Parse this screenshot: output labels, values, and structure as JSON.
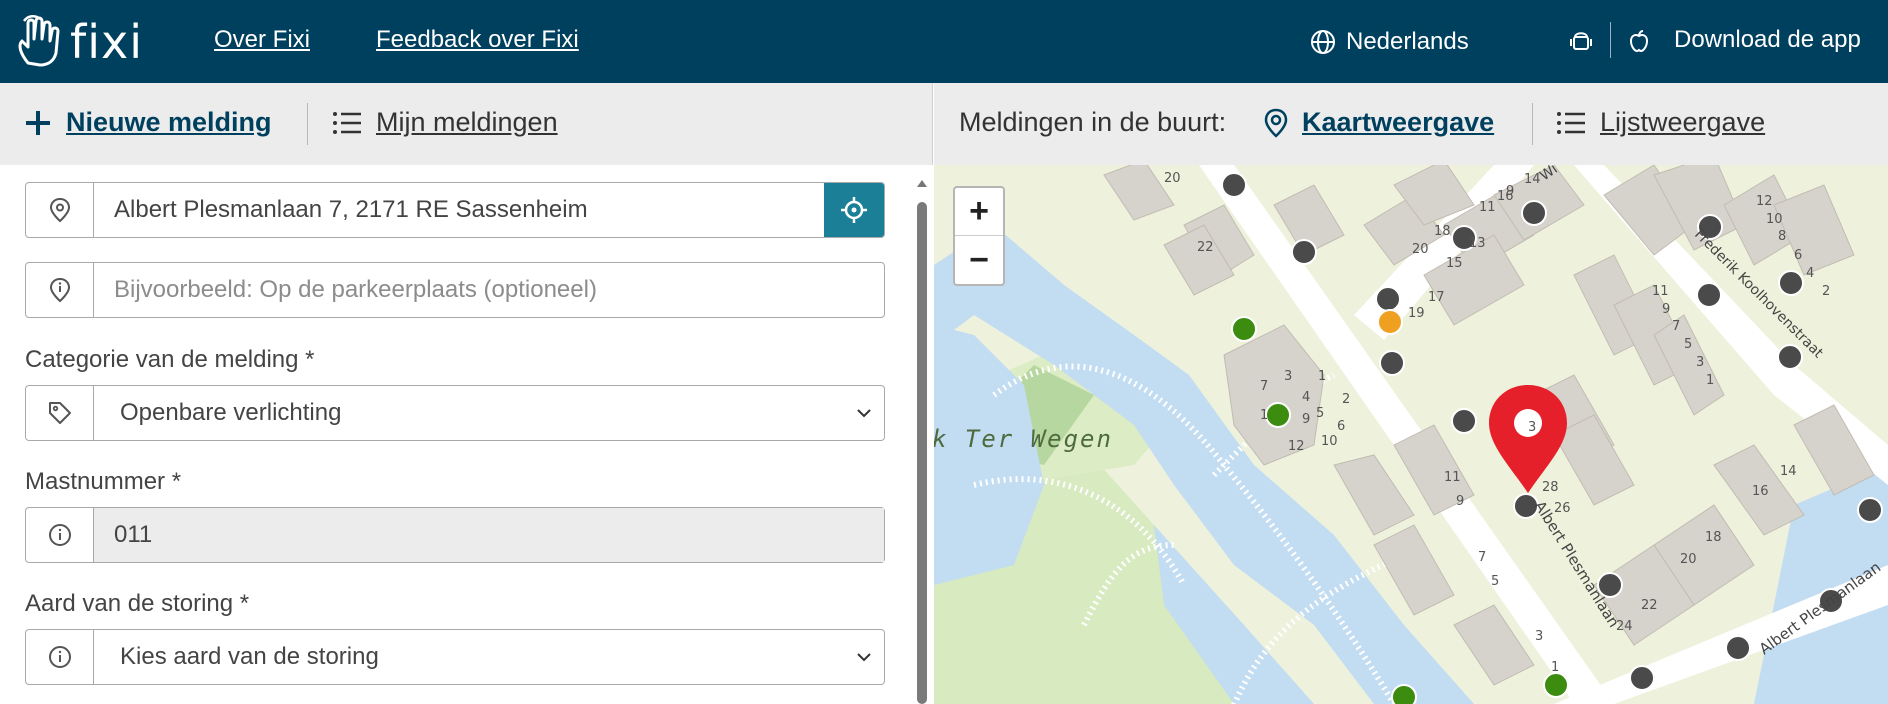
{
  "header": {
    "logo_text": "fixi",
    "nav": [
      "Over Fixi",
      "Feedback over Fixi"
    ],
    "language": "Nederlands",
    "download": "Download de app"
  },
  "toolbar": {
    "new_report": "Nieuwe melding",
    "my_reports": "Mijn meldingen",
    "nearby_label": "Meldingen in de buurt:",
    "map_view": "Kaartweergave",
    "list_view": "Lijstweergave"
  },
  "form": {
    "address_value": "Albert Plesmanlaan 7, 2171 RE Sassenheim",
    "location_placeholder": "Bijvoorbeeld: Op de parkeerplaats (optioneel)",
    "category_label": "Categorie van de melding *",
    "category_value": "Openbare verlichting",
    "mast_label": "Mastnummer *",
    "mast_value": "011",
    "fault_label": "Aard van de storing *",
    "fault_value": "Kies aard van de storing"
  },
  "map": {
    "zoom_in": "+",
    "zoom_out": "−",
    "labels": {
      "park": "k Ter Wegen",
      "street_a": "Albert Plesmanlaan",
      "street_b": "Albert Plesmanlaan",
      "street_c": "Frederik Koolhovenstraat",
      "street_d": "Wi"
    },
    "house_numbers": [
      "20",
      "22",
      "16",
      "14",
      "18",
      "20",
      "13",
      "11",
      "9",
      "15",
      "17",
      "19",
      "12",
      "10",
      "8",
      "6",
      "4",
      "2",
      "11",
      "9",
      "7",
      "5",
      "3",
      "1",
      "7",
      "3",
      "1",
      "4",
      "2",
      "5",
      "9",
      "6",
      "12",
      "10",
      "1",
      "3",
      "28",
      "26",
      "11",
      "9",
      "7",
      "5",
      "3",
      "1",
      "14",
      "16",
      "18",
      "20",
      "22",
      "24"
    ],
    "colors": {
      "marker_red": "#e5202a",
      "dot_gray": "#4a4a4a",
      "dot_green": "#3c8c10",
      "dot_orange": "#f0a020",
      "water": "#c0dcf2",
      "grass": "#d4e8b8",
      "building": "#d6d2cc"
    }
  }
}
